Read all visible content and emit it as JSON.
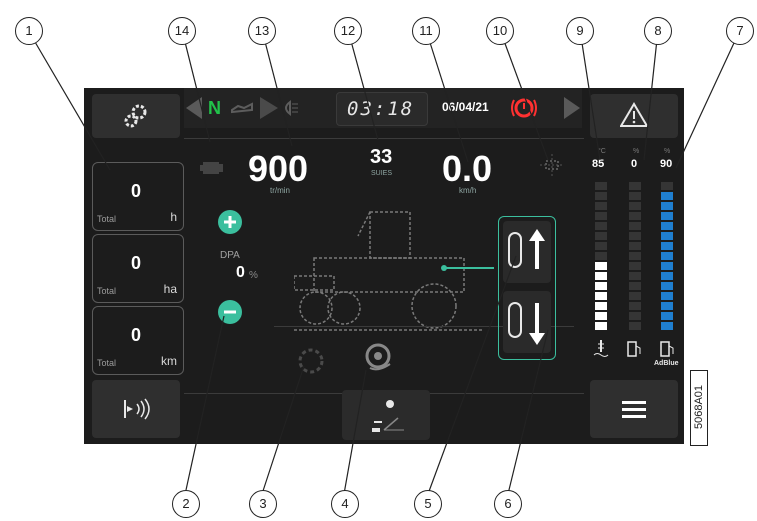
{
  "top": {
    "gear_label": "N",
    "time": "03:18",
    "date": "06/04/21"
  },
  "counters": [
    {
      "value": "0",
      "total": "Total",
      "unit": "h"
    },
    {
      "value": "0",
      "total": "Total",
      "unit": "ha"
    },
    {
      "value": "0",
      "total": "Total",
      "unit": "km"
    }
  ],
  "engine": {
    "rpm": "900",
    "unit": "tr/min"
  },
  "center": {
    "value": "33",
    "label": "SUIES"
  },
  "speed": {
    "value": "0.0",
    "unit": "km/h"
  },
  "dpa": {
    "label": "DPA",
    "value": "0",
    "unit": "%"
  },
  "gauges": [
    {
      "unit": "°C",
      "value": "85",
      "fill_segments": 7,
      "color": "#ffffff"
    },
    {
      "unit": "%",
      "value": "0",
      "fill_segments": 0,
      "color": "#ffffff"
    },
    {
      "unit": "%",
      "value": "90",
      "fill_segments": 14,
      "color": "#1f7fd0",
      "footer": "AdBlue"
    }
  ],
  "side_code": "5068A01",
  "callouts": [
    "1",
    "2",
    "3",
    "4",
    "5",
    "6",
    "7",
    "8",
    "9",
    "10",
    "11",
    "12",
    "13",
    "14"
  ],
  "colors": {
    "accent": "#3bbf9e",
    "warning_red": "#ff3131",
    "gear_green": "#21c24a",
    "adblue": "#1f7fd0"
  },
  "icons": [
    "settings-icon",
    "warning-triangle-icon",
    "menu-icon",
    "sensor-icon",
    "engine-icon",
    "oil-icon",
    "headlight-icon",
    "brake-icon",
    "transmission-icon",
    "arrow-left-icon",
    "arrow-right-icon",
    "plus-icon",
    "minus-icon",
    "loading-icon",
    "wheel-icon",
    "raise-icon",
    "lower-icon",
    "graph-icon"
  ]
}
